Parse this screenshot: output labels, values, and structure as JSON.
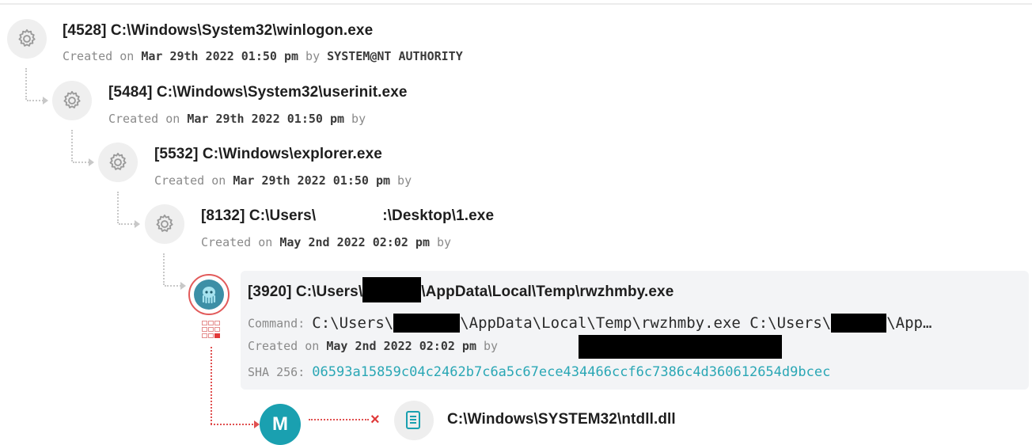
{
  "tree": {
    "nodes": [
      {
        "title": "[4528] C:\\Windows\\System32\\winlogon.exe",
        "created_prefix": "Created on ",
        "created_date": "Mar 29th 2022 01:50 pm",
        "by_label": " by ",
        "user": "SYSTEM@NT AUTHORITY"
      },
      {
        "title": "[5484] C:\\Windows\\System32\\userinit.exe",
        "created_prefix": "Created on ",
        "created_date": "Mar 29th 2022 01:50 pm",
        "by_label": " by"
      },
      {
        "title": "[5532] C:\\Windows\\explorer.exe",
        "created_prefix": "Created on ",
        "created_date": "Mar 29th 2022 01:50 pm",
        "by_label": " by"
      },
      {
        "title_part1": "[8132] C:\\Users\\",
        "title_part2": ":\\Desktop\\1.exe",
        "created_prefix": "Created on ",
        "created_date": "May 2nd 2022 02:02 pm",
        "by_label": " by"
      }
    ],
    "selected": {
      "title_part1": "[3920] C:\\Users\\",
      "title_part2": "\\AppData\\Local\\Temp\\rwzhmby.exe",
      "command_label": "Command:",
      "command_part1": "C:\\Users\\",
      "command_part2": "\\AppData\\Local\\Temp\\rwzhmby.exe C:\\Users\\",
      "command_part3": "\\App…",
      "created_prefix": "Created on ",
      "created_date": "May 2nd 2022 02:02 pm",
      "by_label": " by",
      "sha_label": "SHA 256:",
      "sha_value": "06593a15859c04c2462b7c6a5c67ece434466ccf6c7386c4d360612654d9bcec"
    },
    "module": {
      "badge": "M",
      "path": "C:\\Windows\\SYSTEM32\\ntdll.dll"
    }
  },
  "icons": {
    "process": "gear-icon",
    "selected_process": "octopus-icon",
    "indicator": "grid-icon",
    "module_badge": "m-badge-icon",
    "file": "document-icon",
    "connector_cross": "x-icon"
  },
  "colors": {
    "accent_teal": "#1aa0b0",
    "sha_teal": "#2aa7b5",
    "alert_red": "#e03a3a",
    "card_bg": "#f3f4f6"
  }
}
